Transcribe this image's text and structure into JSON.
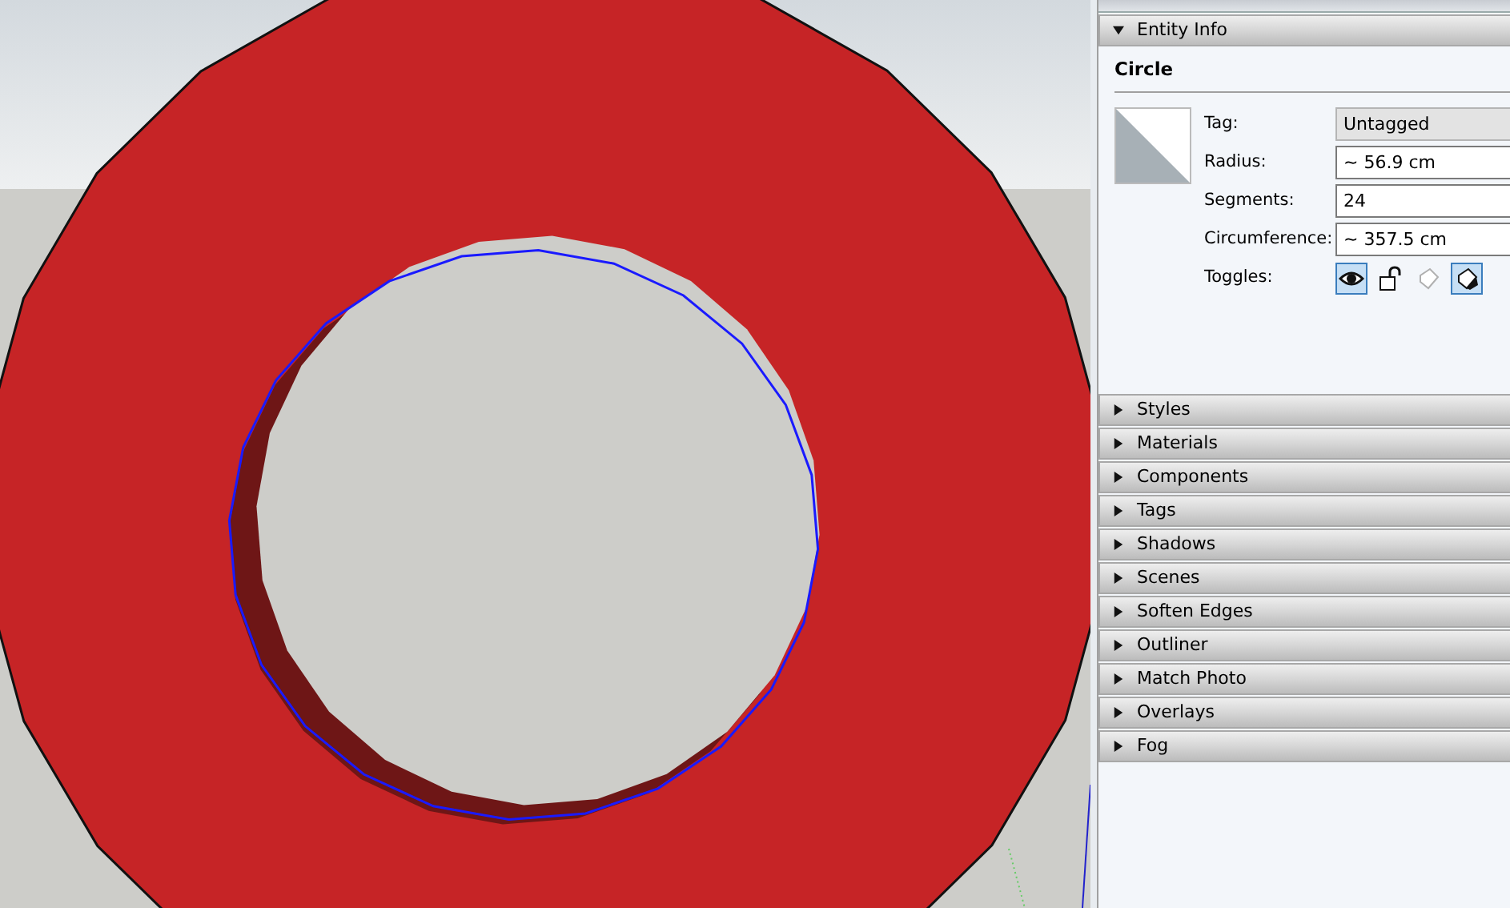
{
  "entity_info": {
    "title": "Entity Info",
    "expanded": true,
    "entity_type": "Circle",
    "fields": [
      {
        "label": "Tag:",
        "value": "Untagged",
        "kind": "dropdown"
      },
      {
        "label": "Radius:",
        "value": "~ 56.9 cm",
        "kind": "text"
      },
      {
        "label": "Segments:",
        "value": "24",
        "kind": "text"
      },
      {
        "label": "Circumference:",
        "value": "~ 357.5 cm",
        "kind": "text"
      }
    ],
    "toggles_label": "Toggles:",
    "toggles": [
      {
        "kind": "visible",
        "on": true,
        "disabled": false
      },
      {
        "kind": "lock",
        "on": false,
        "disabled": false
      },
      {
        "kind": "shadow-receive",
        "on": false,
        "disabled": true
      },
      {
        "kind": "shadow-cast",
        "on": true,
        "disabled": false
      }
    ]
  },
  "panels": [
    {
      "title": "Styles",
      "expanded": false
    },
    {
      "title": "Materials",
      "expanded": false
    },
    {
      "title": "Components",
      "expanded": false
    },
    {
      "title": "Tags",
      "expanded": false
    },
    {
      "title": "Shadows",
      "expanded": false
    },
    {
      "title": "Scenes",
      "expanded": false
    },
    {
      "title": "Soften Edges",
      "expanded": false
    },
    {
      "title": "Outliner",
      "expanded": false
    },
    {
      "title": "Match Photo",
      "expanded": false
    },
    {
      "title": "Overlays",
      "expanded": false
    },
    {
      "title": "Fog",
      "expanded": false
    }
  ]
}
